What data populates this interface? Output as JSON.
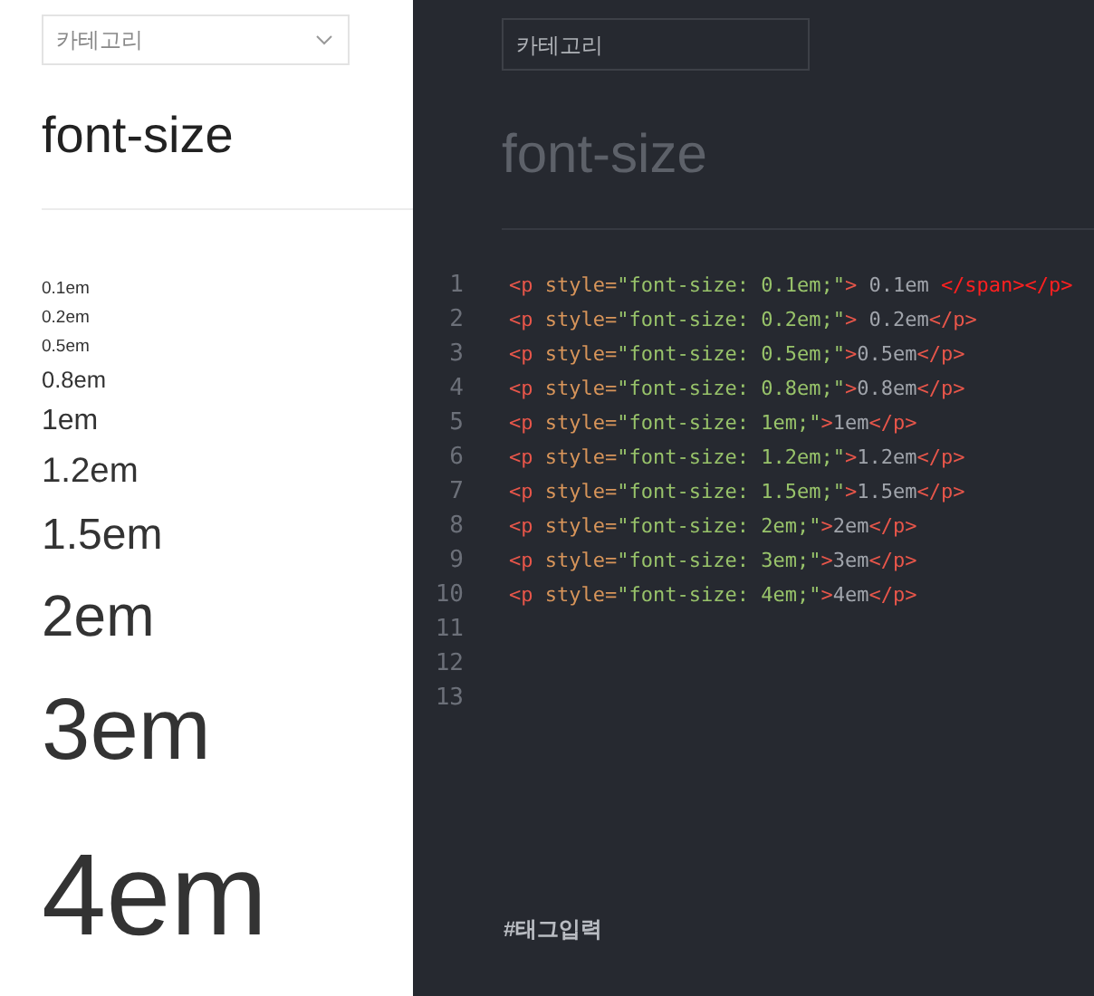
{
  "preview_pane": {
    "category_select": {
      "placeholder": "카테고리"
    },
    "title": "font-size",
    "samples": [
      "0.1em",
      "0.2em",
      "0.5em",
      "0.8em",
      "1em",
      "1.2em",
      "1.5em",
      "2em",
      "3em",
      "4em"
    ]
  },
  "editor_pane": {
    "category_field": {
      "placeholder": "카테고리"
    },
    "title": "font-size",
    "code_lines": [
      {
        "number": "1",
        "tokens": [
          {
            "kind": "tag",
            "text": "<p"
          },
          {
            "kind": "attr",
            "text": " style="
          },
          {
            "kind": "string",
            "text": "\"font-size: 0.1em;\""
          },
          {
            "kind": "tag",
            "text": ">"
          },
          {
            "kind": "text",
            "text": " 0.1em "
          },
          {
            "kind": "error",
            "text": "</span></p>"
          }
        ]
      },
      {
        "number": "2",
        "tokens": [
          {
            "kind": "tag",
            "text": "<p"
          },
          {
            "kind": "attr",
            "text": " style="
          },
          {
            "kind": "string",
            "text": "\"font-size: 0.2em;\""
          },
          {
            "kind": "tag",
            "text": ">"
          },
          {
            "kind": "text",
            "text": " 0.2em"
          },
          {
            "kind": "tag",
            "text": "</p>"
          }
        ]
      },
      {
        "number": "3",
        "tokens": [
          {
            "kind": "tag",
            "text": "<p"
          },
          {
            "kind": "attr",
            "text": " style="
          },
          {
            "kind": "string",
            "text": "\"font-size: 0.5em;\""
          },
          {
            "kind": "tag",
            "text": ">"
          },
          {
            "kind": "text",
            "text": "0.5em"
          },
          {
            "kind": "tag",
            "text": "</p>"
          }
        ]
      },
      {
        "number": "4",
        "tokens": [
          {
            "kind": "tag",
            "text": "<p"
          },
          {
            "kind": "attr",
            "text": " style="
          },
          {
            "kind": "string",
            "text": "\"font-size: 0.8em;\""
          },
          {
            "kind": "tag",
            "text": ">"
          },
          {
            "kind": "text",
            "text": "0.8em"
          },
          {
            "kind": "tag",
            "text": "</p>"
          }
        ]
      },
      {
        "number": "5",
        "tokens": [
          {
            "kind": "tag",
            "text": "<p"
          },
          {
            "kind": "attr",
            "text": " style="
          },
          {
            "kind": "string",
            "text": "\"font-size: 1em;\""
          },
          {
            "kind": "tag",
            "text": ">"
          },
          {
            "kind": "text",
            "text": "1em"
          },
          {
            "kind": "tag",
            "text": "</p>"
          }
        ]
      },
      {
        "number": "6",
        "tokens": [
          {
            "kind": "tag",
            "text": "<p"
          },
          {
            "kind": "attr",
            "text": " style="
          },
          {
            "kind": "string",
            "text": "\"font-size: 1.2em;\""
          },
          {
            "kind": "tag",
            "text": ">"
          },
          {
            "kind": "text",
            "text": "1.2em"
          },
          {
            "kind": "tag",
            "text": "</p>"
          }
        ]
      },
      {
        "number": "7",
        "tokens": [
          {
            "kind": "tag",
            "text": "<p"
          },
          {
            "kind": "attr",
            "text": " style="
          },
          {
            "kind": "string",
            "text": "\"font-size: 1.5em;\""
          },
          {
            "kind": "tag",
            "text": ">"
          },
          {
            "kind": "text",
            "text": "1.5em"
          },
          {
            "kind": "tag",
            "text": "</p>"
          }
        ]
      },
      {
        "number": "8",
        "tokens": [
          {
            "kind": "tag",
            "text": "<p"
          },
          {
            "kind": "attr",
            "text": " style="
          },
          {
            "kind": "string",
            "text": "\"font-size: 2em;\""
          },
          {
            "kind": "tag",
            "text": ">"
          },
          {
            "kind": "text",
            "text": "2em"
          },
          {
            "kind": "tag",
            "text": "</p>"
          }
        ]
      },
      {
        "number": "9",
        "tokens": [
          {
            "kind": "tag",
            "text": "<p"
          },
          {
            "kind": "attr",
            "text": " style="
          },
          {
            "kind": "string",
            "text": "\"font-size: 3em;\""
          },
          {
            "kind": "tag",
            "text": ">"
          },
          {
            "kind": "text",
            "text": "3em"
          },
          {
            "kind": "tag",
            "text": "</p>"
          }
        ]
      },
      {
        "number": "10",
        "tokens": [
          {
            "kind": "tag",
            "text": "<p"
          },
          {
            "kind": "attr",
            "text": " style="
          },
          {
            "kind": "string",
            "text": "\"font-size: 4em;\""
          },
          {
            "kind": "tag",
            "text": ">"
          },
          {
            "kind": "text",
            "text": "4em"
          },
          {
            "kind": "tag",
            "text": "</p>"
          }
        ]
      },
      {
        "number": "11"
      },
      {
        "number": "12"
      },
      {
        "number": "13"
      }
    ],
    "tag_field": {
      "placeholder": "#태그입력"
    }
  }
}
